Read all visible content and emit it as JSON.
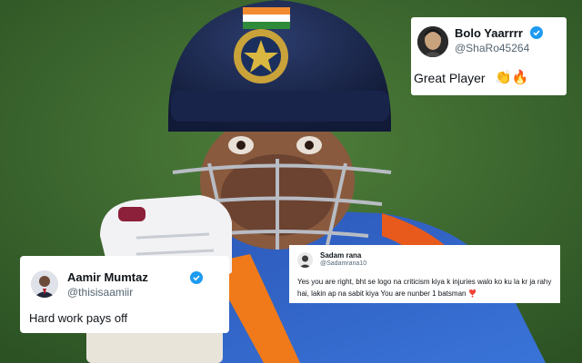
{
  "colors": {
    "field": "#3d6b2e",
    "helmet": "#1d2b52",
    "jersey": "#2f63c9",
    "verified": "#1d9bf0",
    "text": "#0f1419",
    "handle": "#536471"
  },
  "tweets": [
    {
      "name": "Bolo Yaarrrr",
      "handle": "@ShaRo45264",
      "text": "Great Player",
      "emojis": "👏🔥",
      "verified": true
    },
    {
      "name": "Aamir Mumtaz",
      "handle": "@thisisaamiir",
      "text": "Hard work pays off",
      "verified": true
    },
    {
      "name": "Sadam rana",
      "handle": "@Sadamrana10",
      "text": "Yes you are right, bht se logo na criticism kiya k injuries walo ko ku la kr ja rahy hai, lakin ap na sabit kiya You are nunber 1 batsman",
      "emojis": "❣️",
      "verified": false
    }
  ]
}
